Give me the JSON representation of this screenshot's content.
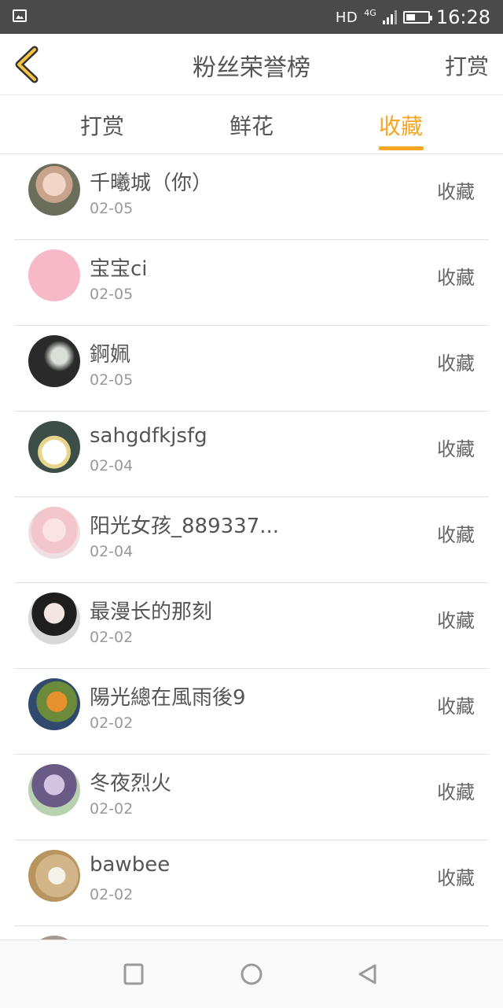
{
  "status_bar": {
    "network": "HD",
    "network_sub": "4G",
    "time": "16:28",
    "battery_level": 0.42
  },
  "header": {
    "title": "粉丝荣誉榜",
    "action": "打赏"
  },
  "tabs": [
    {
      "label": "打赏",
      "active": false
    },
    {
      "label": "鲜花",
      "active": false
    },
    {
      "label": "收藏",
      "active": true
    }
  ],
  "list": [
    {
      "name": "千曦城（你）",
      "date": "02-05",
      "action": "收藏"
    },
    {
      "name": "宝宝ci",
      "date": "02-05",
      "action": "收藏"
    },
    {
      "name": "錒姵",
      "date": "02-05",
      "action": "收藏"
    },
    {
      "name": "sahgdfkjsfg",
      "date": "02-04",
      "action": "收藏"
    },
    {
      "name": "阳光女孩_889337...",
      "date": "02-04",
      "action": "收藏"
    },
    {
      "name": "最漫长的那刻",
      "date": "02-02",
      "action": "收藏"
    },
    {
      "name": "陽光總在風雨後9",
      "date": "02-02",
      "action": "收藏"
    },
    {
      "name": "冬夜烈火",
      "date": "02-02",
      "action": "收藏"
    },
    {
      "name": "bawbee",
      "date": "02-02",
      "action": "收藏"
    },
    {
      "name": "",
      "date": "",
      "action": ""
    }
  ],
  "colors": {
    "accent": "#f5a623",
    "status_bar": "#4a4a4a",
    "text": "#555555",
    "subtext": "#999999"
  }
}
